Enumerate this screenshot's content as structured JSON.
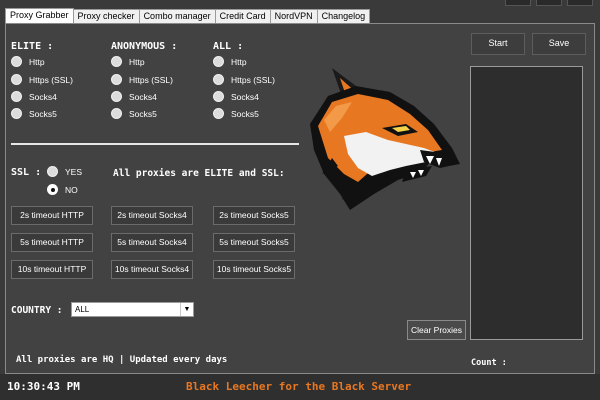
{
  "tabs": [
    {
      "label": "Proxy Grabber",
      "active": true
    },
    {
      "label": "Proxy checker",
      "active": false
    },
    {
      "label": "Combo manager",
      "active": false
    },
    {
      "label": "Credit Card",
      "active": false
    },
    {
      "label": "NordVPN",
      "active": false
    },
    {
      "label": "Changelog",
      "active": false
    }
  ],
  "columns": [
    {
      "title": "ELITE :",
      "options": [
        "Http",
        "Https (SSL)",
        "Socks4",
        "Socks5"
      ]
    },
    {
      "title": "ANONYMOUS :",
      "options": [
        "Http",
        "Https (SSL)",
        "Socks4",
        "Socks5"
      ]
    },
    {
      "title": "ALL :",
      "options": [
        "Http",
        "Https (SSL)",
        "Socks4",
        "Socks5"
      ]
    }
  ],
  "ssl": {
    "label": "SSL :",
    "yes": "YES",
    "no": "NO",
    "selected": "NO",
    "note": "All proxies are ELITE and SSL:"
  },
  "timeout_buttons": [
    [
      "2s timeout HTTP",
      "2s timeout Socks4",
      "2s timeout Socks5"
    ],
    [
      "5s timeout HTTP",
      "5s timeout Socks4",
      "5s timeout Socks5"
    ],
    [
      "10s timeout HTTP",
      "10s timeout Socks4",
      "10s timeout Socks5"
    ]
  ],
  "country": {
    "label": "COUNTRY :",
    "value": "ALL"
  },
  "actions": {
    "start": "Start",
    "save": "Save",
    "clear": "Clear Proxies"
  },
  "count_label": "Count :",
  "footer": {
    "info": "All proxies are HQ | Updated every days",
    "time": "10:30:43 PM",
    "title": "Black Leecher for the Black Server"
  },
  "logo": "fox-head-logo",
  "colors": {
    "accent": "#e87722",
    "background": "#424242",
    "panel_dark": "#2d2d2d"
  }
}
